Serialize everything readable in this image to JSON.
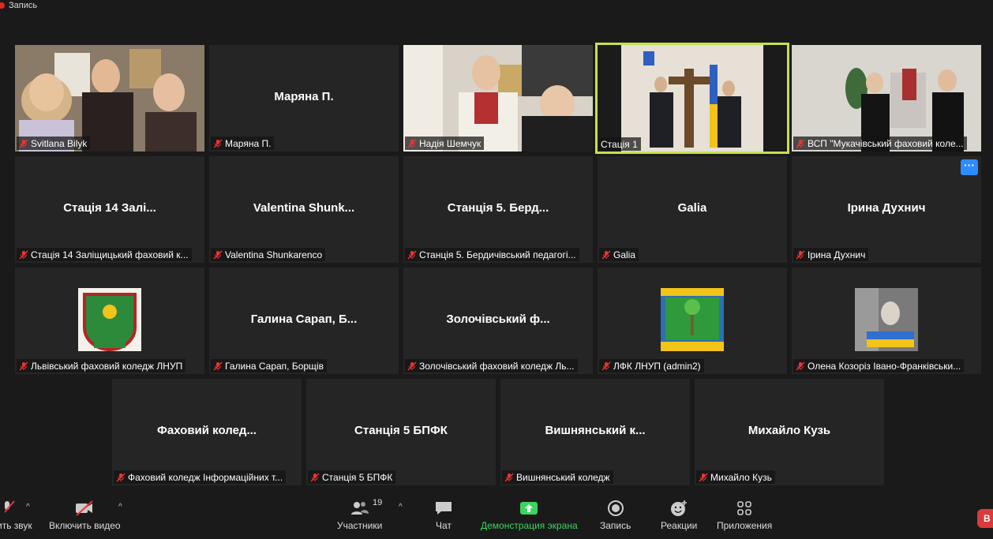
{
  "recording": {
    "label": "Запись"
  },
  "tiles": [
    {
      "name": "Svitlana Bilyk",
      "center": ""
    },
    {
      "name": "Маряна П.",
      "center": "Маряна П."
    },
    {
      "name": "Надія Шемчук",
      "center": ""
    },
    {
      "name": "Стація 1",
      "center": ""
    },
    {
      "name": "ВСП \"Мукачівський фаховий коле...",
      "center": ""
    },
    {
      "name": "Стація 14  Заліщицький фаховий к...",
      "center": "Стація 14  Залі..."
    },
    {
      "name": "Valentina Shunkarenco",
      "center": "Valentina  Shunk..."
    },
    {
      "name": "Станція 5. Бердичівський педагогі...",
      "center": "Станція 5. Берд..."
    },
    {
      "name": "Galia",
      "center": "Galia"
    },
    {
      "name": "Ірина Духнич",
      "center": "Ірина Духнич"
    },
    {
      "name": "Львівський фаховий коледж ЛНУП",
      "center": ""
    },
    {
      "name": "Галина Сарап, Борщів",
      "center": "Галина Сарап,  Б..."
    },
    {
      "name": "Золочівський фаховий коледж Ль...",
      "center": "Золочівський  ф..."
    },
    {
      "name": "ЛФК ЛНУП (admin2)",
      "center": ""
    },
    {
      "name": "Олена Козоріз Івано-Франківськи...",
      "center": ""
    },
    {
      "name": "Фаховий коледж Інформаційних т...",
      "center": "Фаховий  колед..."
    },
    {
      "name": "Станція 5 БПФК",
      "center": "Станція 5 БПФК"
    },
    {
      "name": "Вишнянський коледж",
      "center": "Вишнянський  к..."
    },
    {
      "name": "Михайло Кузь",
      "center": "Михайло Кузь"
    }
  ],
  "toolbar": {
    "audio_label": "ить звук",
    "video_label": "Включить видео",
    "participants_label": "Участники",
    "participants_count": "19",
    "chat_label": "Чат",
    "share_label": "Демонстрация экрана",
    "record_label": "Запись",
    "reactions_label": "Реакции",
    "apps_label": "Приложения",
    "end_label": "В"
  },
  "colors": {
    "active_speaker": "#c6e14a",
    "share": "#3cd35f",
    "accent": "#2d8cff",
    "end": "#d93b3b"
  }
}
